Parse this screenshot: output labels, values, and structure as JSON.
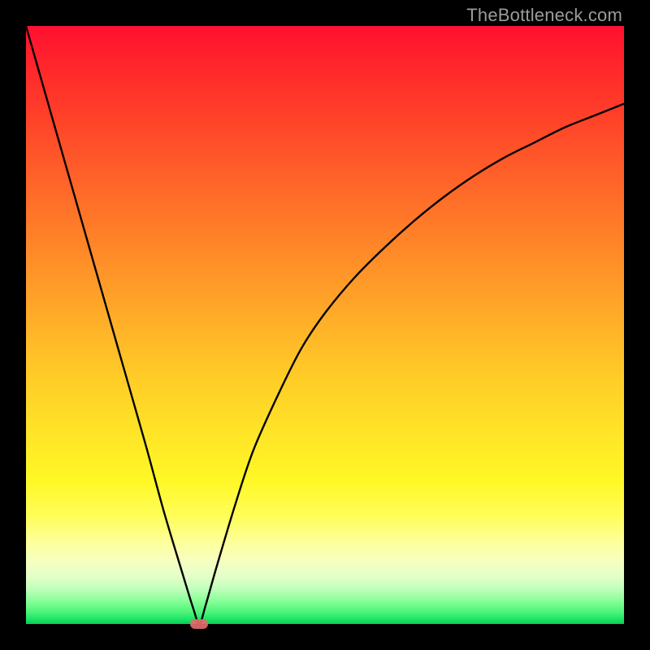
{
  "watermark": "TheBottleneck.com",
  "colors": {
    "curve": "#000000",
    "marker": "#e26a6a",
    "frame": "#000000"
  },
  "chart_data": {
    "type": "line",
    "title": "",
    "xlabel": "",
    "ylabel": "",
    "xlim": [
      0,
      100
    ],
    "ylim": [
      0,
      100
    ],
    "grid": false,
    "legend": false,
    "marker": {
      "x": 29,
      "y": 0,
      "width_pct": 3
    },
    "series": [
      {
        "name": "bottleneck-curve",
        "x": [
          0,
          4,
          8,
          12,
          16,
          20,
          23,
          26,
          28,
          29,
          30,
          32,
          35,
          38,
          42,
          46,
          50,
          55,
          60,
          65,
          70,
          75,
          80,
          85,
          90,
          95,
          100
        ],
        "y": [
          100,
          86,
          72,
          58,
          44,
          30,
          19,
          9,
          2.5,
          0,
          3,
          10,
          20,
          29,
          38,
          46,
          52,
          58,
          63,
          67.5,
          71.5,
          75,
          78,
          80.5,
          83,
          85,
          87
        ]
      }
    ]
  }
}
